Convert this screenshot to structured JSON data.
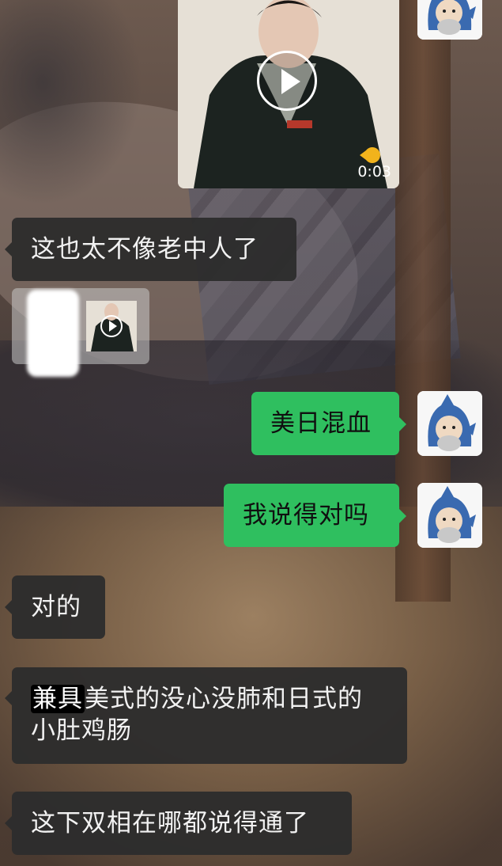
{
  "video_message": {
    "duration": "0:03"
  },
  "messages": [
    {
      "side": "left",
      "text": "这也太不像老中人了"
    },
    {
      "side": "right",
      "text": "美日混血"
    },
    {
      "side": "right",
      "text": "我说得对吗"
    },
    {
      "side": "left",
      "text": "对的"
    },
    {
      "side": "left",
      "highlight": "兼具",
      "text_rest_line1": "美式的没心没肺和日式的",
      "text_line2": "小肚鸡肠"
    },
    {
      "side": "left",
      "text": "这下双相在哪都说得通了"
    }
  ],
  "colors": {
    "right_bubble": "#2fbf5f",
    "left_bubble": "#2d2d2d"
  },
  "icons": {
    "avatar": "shark-costume-avatar-icon",
    "play": "play-icon"
  }
}
